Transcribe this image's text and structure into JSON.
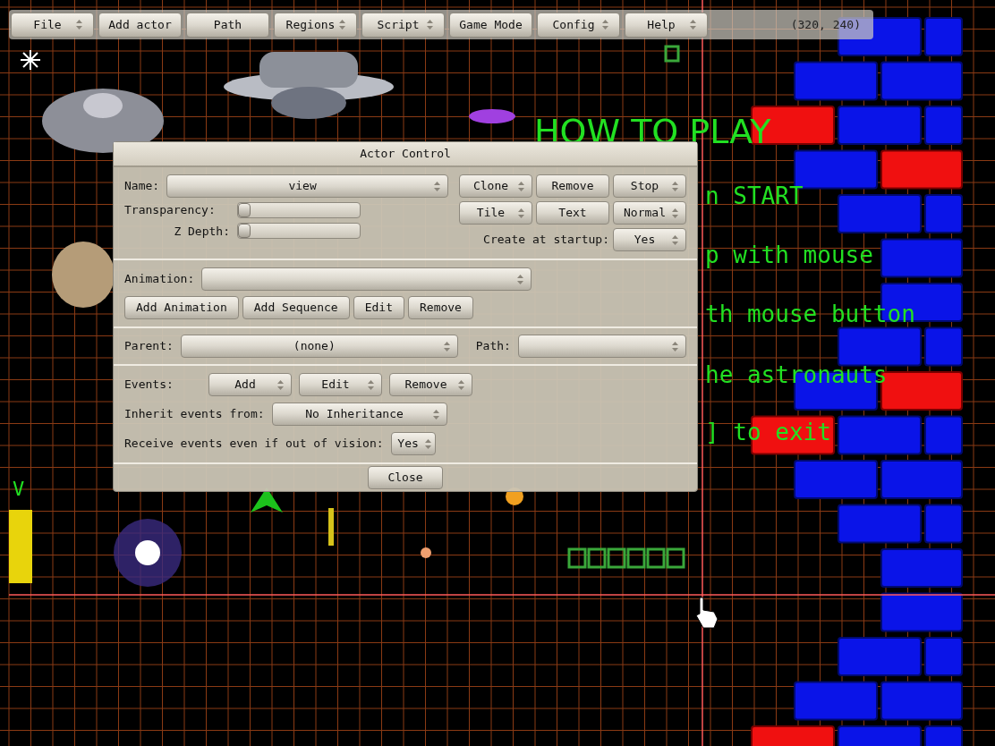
{
  "menu_bar": {
    "items": [
      {
        "label": "File",
        "kind": "dropdown"
      },
      {
        "label": "Add actor",
        "kind": "button"
      },
      {
        "label": "Path",
        "kind": "button"
      },
      {
        "label": "Regions",
        "kind": "dropdown"
      },
      {
        "label": "Script",
        "kind": "dropdown"
      },
      {
        "label": "Game Mode",
        "kind": "button"
      },
      {
        "label": "Config",
        "kind": "dropdown"
      },
      {
        "label": "Help",
        "kind": "dropdown"
      }
    ],
    "coordinates": "(320, 240)"
  },
  "canvas": {
    "title": "HOW TO PLAY",
    "lines": [
      "n START",
      "p with mouse",
      "th mouse button",
      "he astronauts",
      "] to exit"
    ],
    "edge_label": "V"
  },
  "dialog": {
    "title": "Actor Control",
    "name": {
      "label": "Name:",
      "value": "view"
    },
    "sliders": [
      {
        "label": "Transparency:",
        "level": 0
      },
      {
        "label": "Z Depth:",
        "level": 0
      }
    ],
    "actor_buttons": [
      {
        "label": "Clone",
        "kind": "dropdown"
      },
      {
        "label": "Remove",
        "kind": "button"
      },
      {
        "label": "Stop",
        "kind": "dropdown"
      },
      {
        "label": "Tile",
        "kind": "dropdown"
      },
      {
        "label": "Text",
        "kind": "button"
      },
      {
        "label": "Normal",
        "kind": "dropdown"
      }
    ],
    "create_at_startup": {
      "label": "Create at startup:",
      "value": "Yes"
    },
    "animation": {
      "label": "Animation:",
      "buttons": [
        {
          "label": "Add Animation",
          "kind": "button"
        },
        {
          "label": "Add Sequence",
          "kind": "button"
        },
        {
          "label": "Edit",
          "kind": "button"
        },
        {
          "label": "Remove",
          "kind": "button"
        }
      ]
    },
    "parent": {
      "label": "Parent:",
      "value": "(none)"
    },
    "path": {
      "label": "Path:"
    },
    "events": {
      "label": "Events:",
      "buttons": [
        {
          "label": "Add",
          "kind": "dropdown"
        },
        {
          "label": "Edit",
          "kind": "dropdown"
        },
        {
          "label": "Remove",
          "kind": "dropdown"
        }
      ]
    },
    "inherit": {
      "label": "Inherit events from:",
      "value": "No Inheritance"
    },
    "receive": {
      "label": "Receive events even if out of vision:",
      "value": "Yes"
    },
    "close_button": "Close"
  }
}
